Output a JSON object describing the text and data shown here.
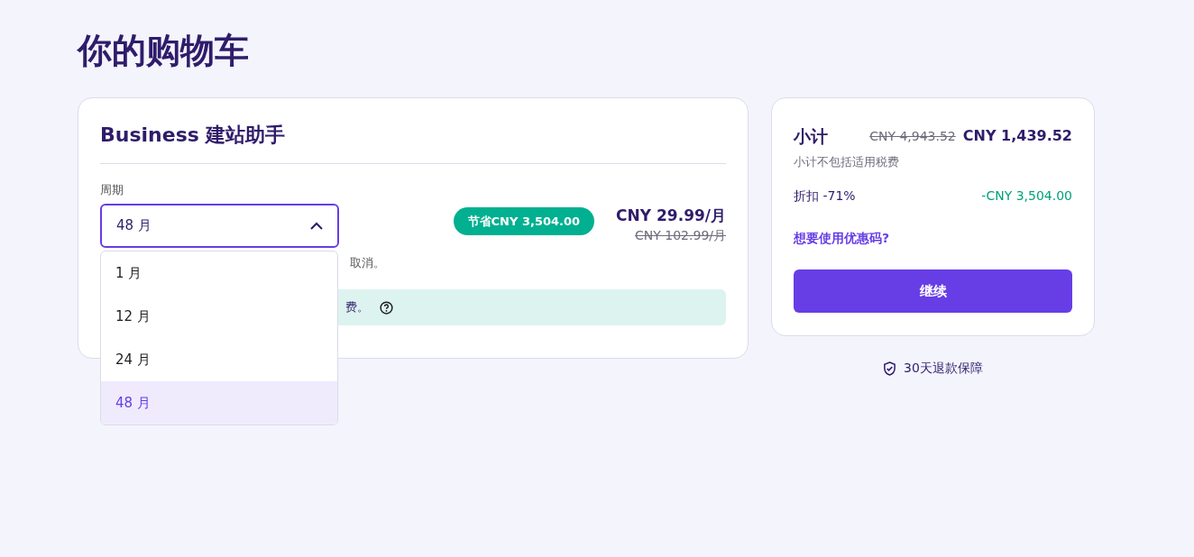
{
  "page_title": "你的购物车",
  "product": {
    "title": "Business 建站助手",
    "period_label": "周期",
    "period_value": "48 月",
    "expanded": true,
    "options": [
      {
        "label": "1 月",
        "selected": false
      },
      {
        "label": "12 月",
        "selected": false
      },
      {
        "label": "24 月",
        "selected": false
      },
      {
        "label": "48 月",
        "selected": true
      }
    ],
    "savings_badge": "节省CNY 3,504.00",
    "price": "CNY 29.99/月",
    "old_price": "CNY 102.99/月",
    "note": "取消。",
    "banner": "费。"
  },
  "summary": {
    "title": "小计",
    "old_total": "CNY 4,943.52",
    "total": "CNY 1,439.52",
    "tax_note": "小计不包括适用税费",
    "discount_label": "折扣 -71%",
    "discount_value": "-CNY 3,504.00",
    "coupon_link": "想要使用优惠码?",
    "continue_button": "继续"
  },
  "guarantee": "30天退款保障"
}
